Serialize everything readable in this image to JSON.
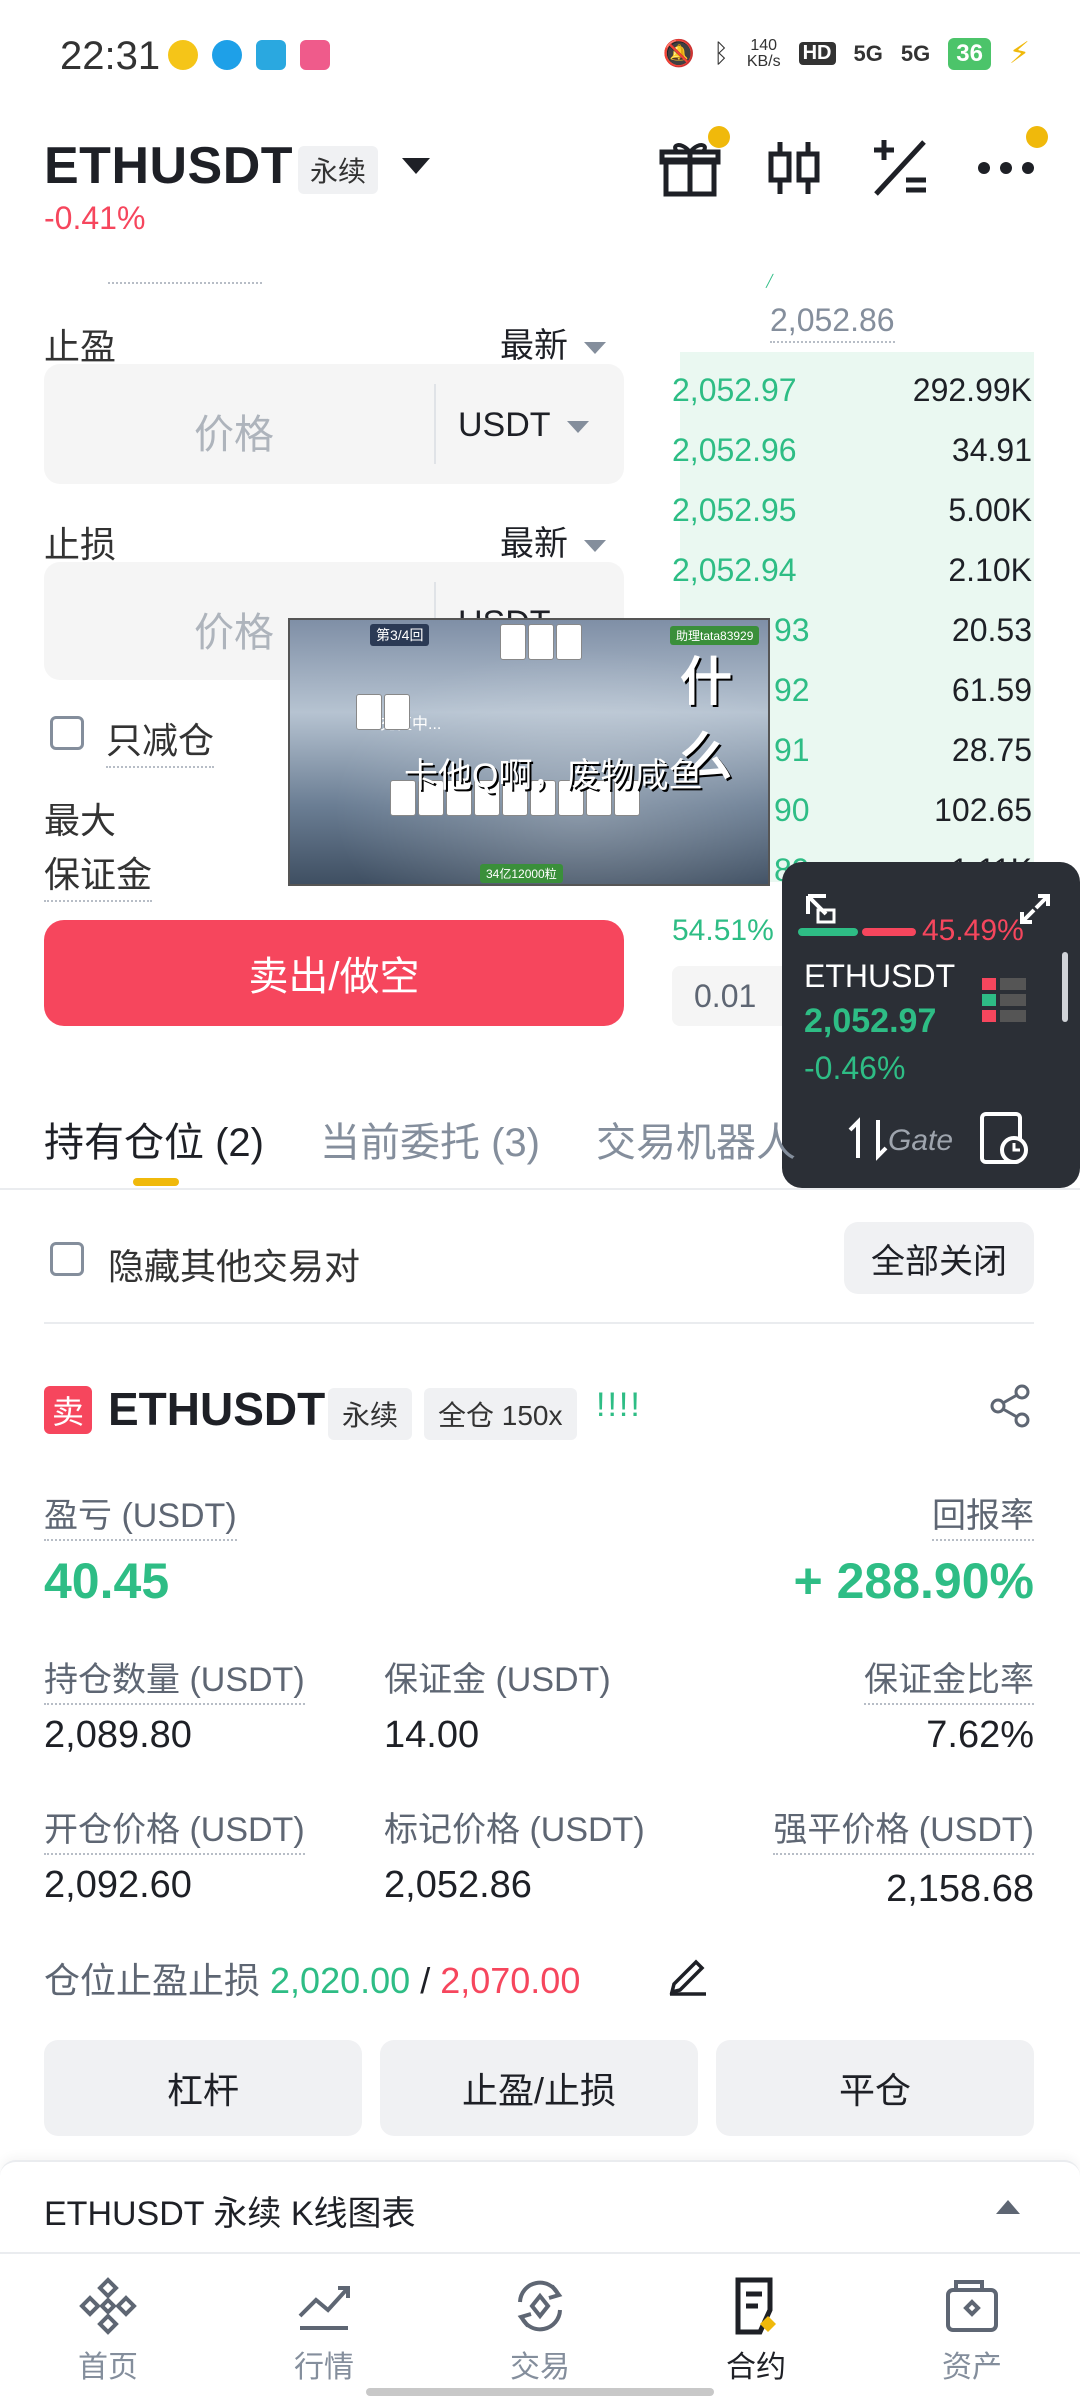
{
  "status_bar": {
    "time": "22:31",
    "net_speed_top": "140",
    "net_speed_unit": "KB/s",
    "hd": "HD",
    "signal_1": "5G",
    "signal_2": "5G",
    "battery": "36"
  },
  "header": {
    "symbol": "ETHUSDT",
    "contract_type": "永续",
    "change_pct": "-0.41%",
    "icons": [
      "gift-icon",
      "candlestick-icon",
      "calculator-icon",
      "more-icon"
    ]
  },
  "order_form": {
    "take_profit_label": "止盈",
    "take_profit_trigger": "最新",
    "take_profit_placeholder": "价格",
    "unit": "USDT",
    "stop_loss_label": "止损",
    "stop_loss_trigger": "最新",
    "stop_loss_placeholder": "价格",
    "stop_loss_unit_partial": "USDT",
    "reduce_only_label": "只减仓",
    "max_margin_label_1": "最大",
    "max_margin_label_2": "保证金",
    "sell_button": "卖出/做空"
  },
  "order_book": {
    "mark_price": "2,052.86",
    "rows": [
      {
        "price": "2,052.97",
        "qty": "292.99K"
      },
      {
        "price": "2,052.96",
        "qty": "34.91"
      },
      {
        "price": "2,052.95",
        "qty": "5.00K"
      },
      {
        "price": "2,052.94",
        "qty": "2.10K"
      },
      {
        "price": "93",
        "qty": "20.53"
      },
      {
        "price": "92",
        "qty": "61.59"
      },
      {
        "price": "91",
        "qty": "28.75"
      },
      {
        "price": "90",
        "qty": "102.65"
      },
      {
        "price": "89",
        "qty": "1.11K"
      }
    ],
    "buy_ratio": "54.51%",
    "sell_ratio": "45.49%",
    "precision": "0.01"
  },
  "video_overlay": {
    "round": "第3/4回",
    "helper": "助理tata83929",
    "big_text": "什么",
    "status": "充值中...",
    "subtitle": "卡他Q啊，废物咸鱼",
    "chips": "34亿12000粒"
  },
  "widget": {
    "symbol": "ETHUSDT",
    "price": "2,052.97",
    "change": "-0.46%",
    "brand": "Gate"
  },
  "tabs": [
    {
      "label": "持有仓位 (2)",
      "active": true
    },
    {
      "label": "当前委托 (3)",
      "active": false
    },
    {
      "label": "交易机器人",
      "active": false
    }
  ],
  "filters": {
    "hide_other_pairs": "隐藏其他交易对",
    "close_all": "全部关闭"
  },
  "position": {
    "side": "卖",
    "symbol": "ETHUSDT",
    "contract_type": "永续",
    "margin_mode": "全仓 150x",
    "bars": "!!!!",
    "pnl_label": "盈亏 (USDT)",
    "pnl_value": "40.45",
    "roe_label": "回报率",
    "roe_value": "+ 288.90%",
    "size_label": "持仓数量 (USDT)",
    "size_value": "2,089.80",
    "margin_label": "保证金 (USDT)",
    "margin_value": "14.00",
    "margin_ratio_label": "保证金比率",
    "margin_ratio_value": "7.62%",
    "entry_label": "开仓价格 (USDT)",
    "entry_value": "2,092.60",
    "mark_label": "标记价格 (USDT)",
    "mark_value": "2,052.86",
    "liq_label": "强平价格 (USDT)",
    "liq_value": "2,158.68",
    "tpsl_label": "仓位止盈止损",
    "tp_value": "2,020.00",
    "sl_separator": "/",
    "sl_value": "2,070.00",
    "buttons": [
      "杠杆",
      "止盈/止损",
      "平仓"
    ]
  },
  "kline": {
    "label": "ETHUSDT 永续 K线图表"
  },
  "bottom_nav": [
    {
      "label": "首页",
      "icon": "home-icon"
    },
    {
      "label": "行情",
      "icon": "markets-icon"
    },
    {
      "label": "交易",
      "icon": "trade-icon"
    },
    {
      "label": "合约",
      "icon": "futures-icon"
    },
    {
      "label": "资产",
      "icon": "wallet-icon"
    }
  ],
  "colors": {
    "green": "#2ebd85",
    "red": "#f6465d",
    "accent": "#f0b90b"
  }
}
